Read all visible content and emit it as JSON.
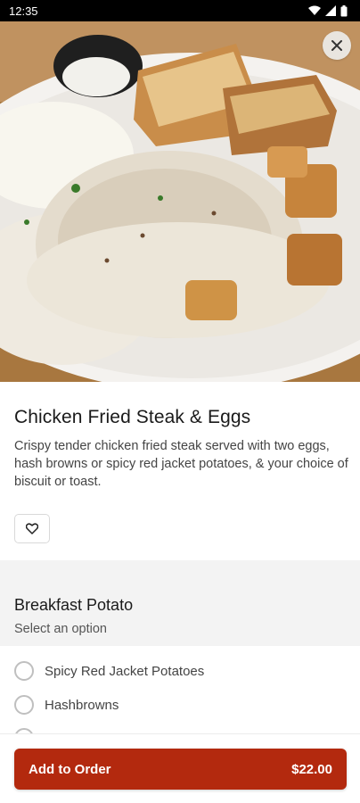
{
  "status_bar": {
    "time": "12:35"
  },
  "item": {
    "title": "Chicken Fried Steak & Eggs",
    "description": "Crispy tender chicken fried steak served with two eggs, hash browns or spicy red jacket potatoes, & your choice of biscuit or toast."
  },
  "modifier_group": {
    "title": "Breakfast Potato",
    "subtitle": "Select an option",
    "options": [
      {
        "label": "Spicy Red Jacket Potatoes",
        "selected": false
      },
      {
        "label": "Hashbrowns",
        "selected": false
      }
    ]
  },
  "footer": {
    "add_label": "Add to Order",
    "price": "$22.00"
  },
  "colors": {
    "accent": "#b3290e"
  },
  "icons": {
    "close": "close-icon",
    "favorite": "heart-icon"
  }
}
